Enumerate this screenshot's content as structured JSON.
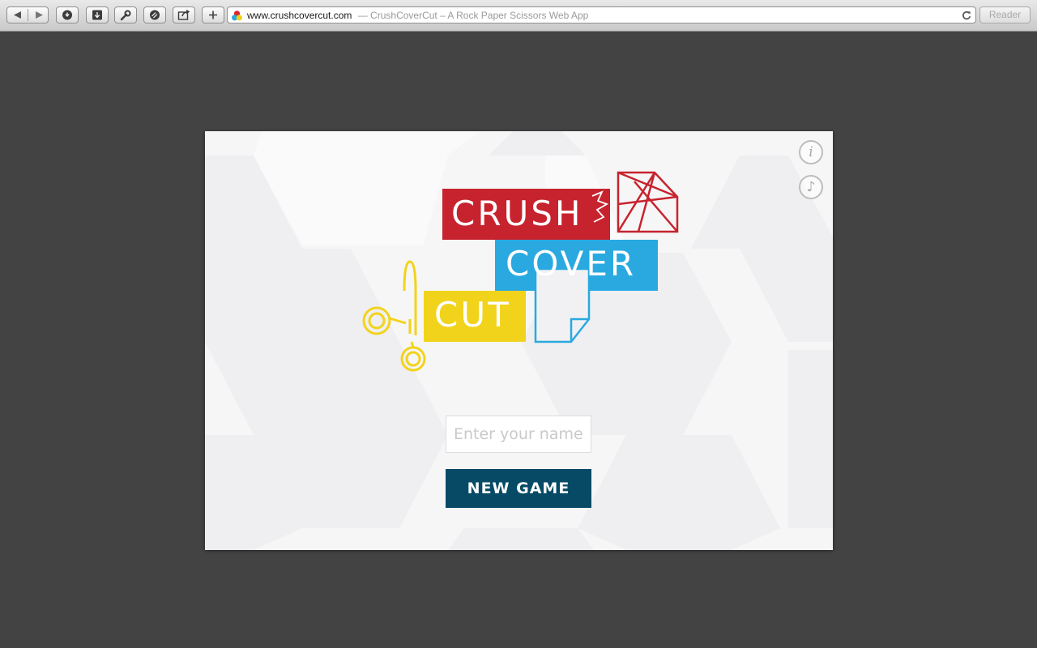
{
  "browser": {
    "url": "www.crushcovercut.com",
    "page_title": "— CrushCoverCut – A Rock Paper Scissors Web App",
    "reader_label": "Reader",
    "icons": {
      "back": "back-arrow-icon",
      "forward": "forward-arrow-icon",
      "history": "history-icon",
      "downloads": "download-icon",
      "tools": "wrench-icon",
      "bookmarks": "bookmark-icon",
      "share": "share-icon",
      "new_tab": "plus-icon",
      "reload": "reload-icon"
    }
  },
  "game": {
    "logo": {
      "crush": "CRUSH",
      "cover": "COVER",
      "cut": "CUT",
      "colors": {
        "crush": "#c7232e",
        "cover": "#29a9e0",
        "cut": "#f2d31b"
      }
    },
    "name_placeholder": "Enter your name...",
    "name_value": "",
    "new_game_label": "NEW GAME",
    "info_glyph": "i",
    "music_glyph": "♪",
    "button_color": "#064a66"
  }
}
